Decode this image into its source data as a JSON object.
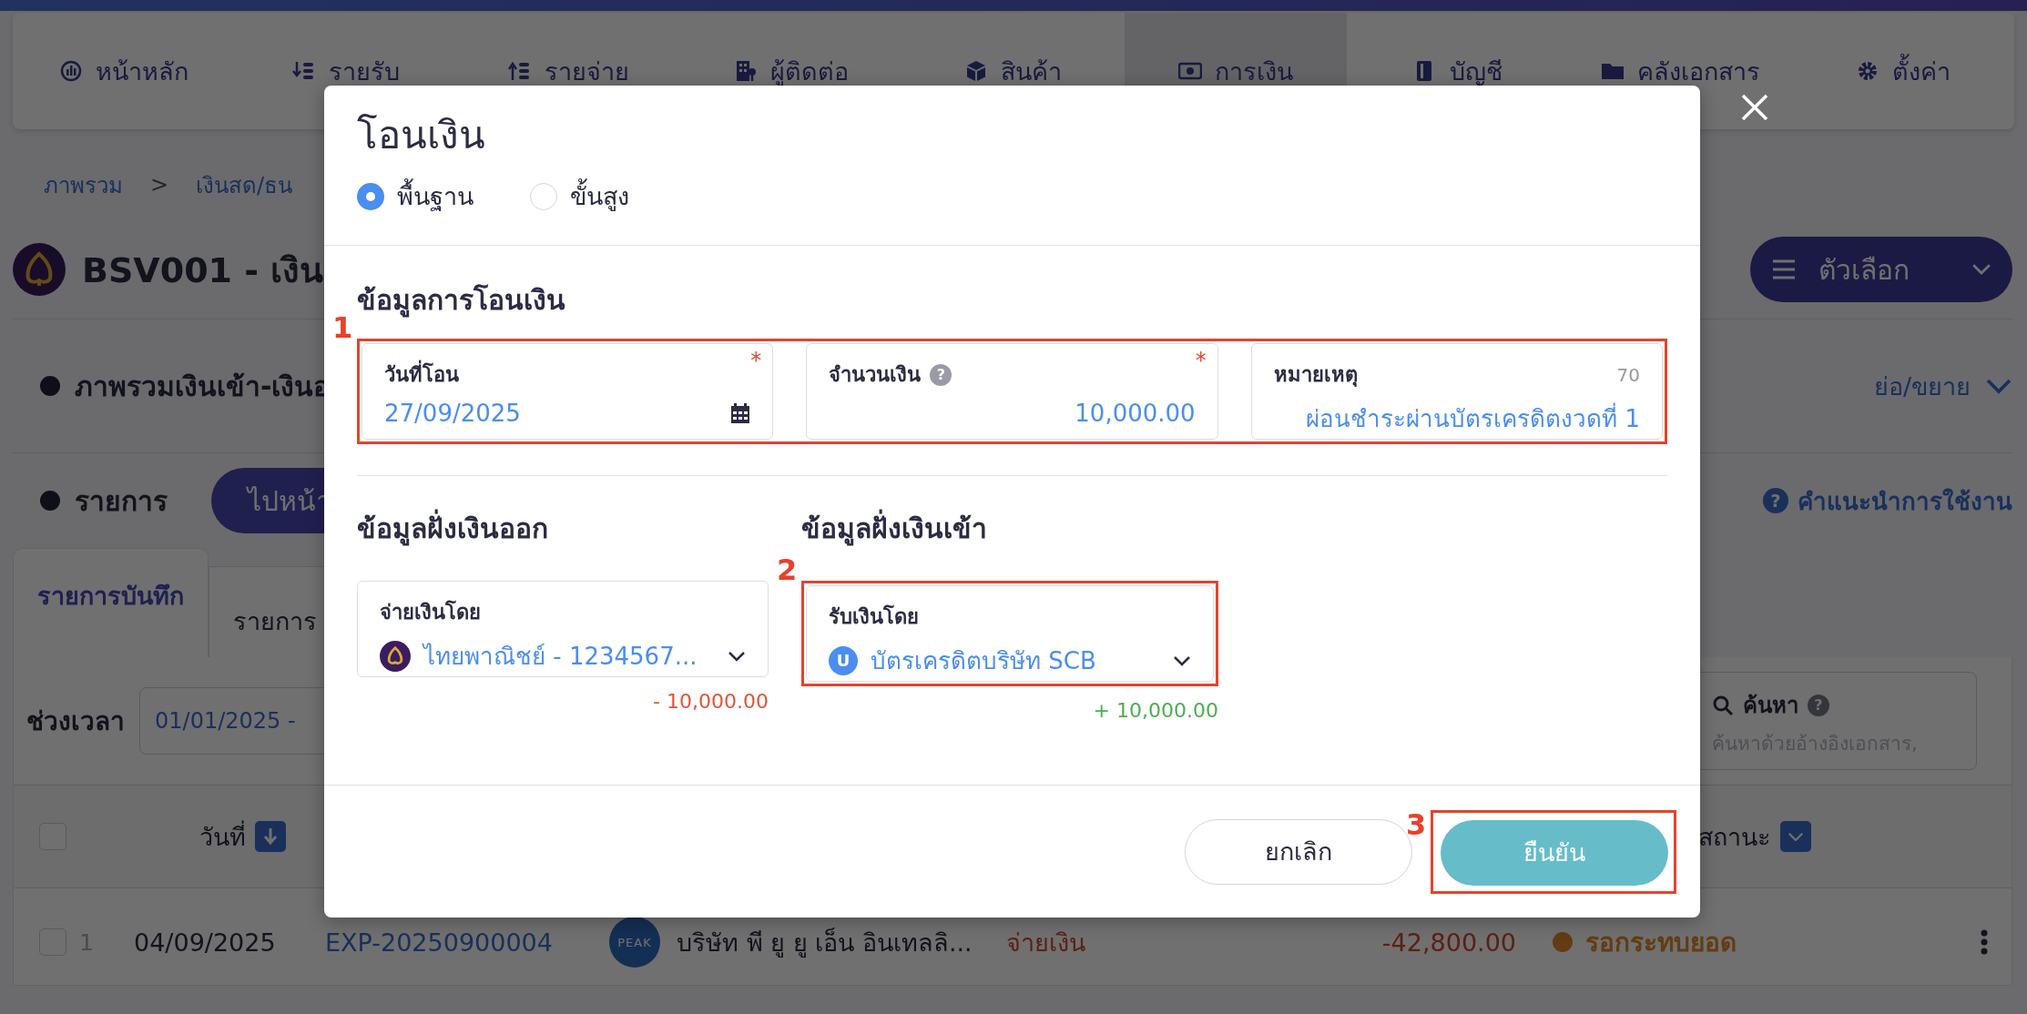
{
  "top_nav": {
    "items": [
      {
        "label": "หน้าหลัก",
        "selected": false
      },
      {
        "label": "รายรับ",
        "selected": false
      },
      {
        "label": "รายจ่าย",
        "selected": false
      },
      {
        "label": "ผู้ติดต่อ",
        "selected": false
      },
      {
        "label": "สินค้า",
        "selected": false
      },
      {
        "label": "การเงิน",
        "selected": true
      },
      {
        "label": "บัญชี",
        "selected": false
      },
      {
        "label": "คลังเอกสาร",
        "selected": false
      },
      {
        "label": "ตั้งค่า",
        "selected": false
      }
    ]
  },
  "breadcrumb": {
    "items": [
      "ภาพรวม",
      "เงินสด/ธน"
    ],
    "separator": ">"
  },
  "account": {
    "title": "BSV001 - เงิน",
    "options_button": "ตัวเลือก"
  },
  "overview_section": {
    "title": "ภาพรวมเงินเข้า-เงินอ",
    "toggle": "ย่อ/ขยาย"
  },
  "transactions_section": {
    "title": "รายการ",
    "goto_button": "ไปหน้า",
    "help_icon": "?",
    "help_link": "คำแนะนำการใช้งาน",
    "tabs": [
      {
        "label": "รายการบันทึก",
        "selected": true
      },
      {
        "label": "รายการ",
        "selected": false
      }
    ],
    "period_label": "ช่วงเวลา",
    "period_value": "01/01/2025 -",
    "search": {
      "label": "ค้นหา",
      "help_icon": "?",
      "placeholder": "ค้นหาด้วยอ้างอิงเอกสาร,"
    }
  },
  "table": {
    "header_checked": false,
    "columns": [
      {
        "label": "วันที่"
      },
      {
        "label": "สถานะ"
      }
    ],
    "rows": [
      {
        "checked": false,
        "index": "1",
        "date": "04/09/2025",
        "document": "EXP-20250900004",
        "avatar": "PEAK",
        "contact": "บริษัท พี ยู ยู เอ็น อินเทลลิ...",
        "type": "จ่ายเงิน",
        "amount": "-42,800.00",
        "status": "รอกระทบยอด"
      }
    ]
  },
  "modal": {
    "title": "โอนเงิน",
    "modes": [
      {
        "label": "พื้นฐาน",
        "selected": true
      },
      {
        "label": "ขั้นสูง",
        "selected": false
      }
    ],
    "transfer_info": {
      "title": "ข้อมูลการโอนเงิน",
      "callout": "1",
      "fields": [
        {
          "kind": "date",
          "label": "วันที่โอน",
          "value": "27/09/2025",
          "required_mark": "*"
        },
        {
          "kind": "amount",
          "label": "จำนวนเงิน",
          "help_icon": "?",
          "value": "10,000.00",
          "required_mark": "*"
        },
        {
          "kind": "note",
          "label": "หมายเหตุ",
          "value": "ผ่อนชำระผ่านบัตรเครดิตงวดที่ 1",
          "counter": "70"
        }
      ]
    },
    "outgoing": {
      "title": "ข้อมูลฝั่งเงินออก",
      "label": "จ่ายเงินโดย",
      "value": "ไทยพาณิชย์ - 1234567...",
      "amount": "- 10,000.00"
    },
    "incoming": {
      "title": "ข้อมูลฝั่งเงินเข้า",
      "label": "รับเงินโดย",
      "value": "บัตรเครดิตบริษัท SCB",
      "avatar": "U",
      "amount": "+ 10,000.00",
      "callout": "2"
    },
    "buttons": [
      {
        "kind": "secondary",
        "label": "ยกเลิก"
      },
      {
        "kind": "primary",
        "label": "ยืนยัน",
        "callout": "3"
      }
    ]
  }
}
